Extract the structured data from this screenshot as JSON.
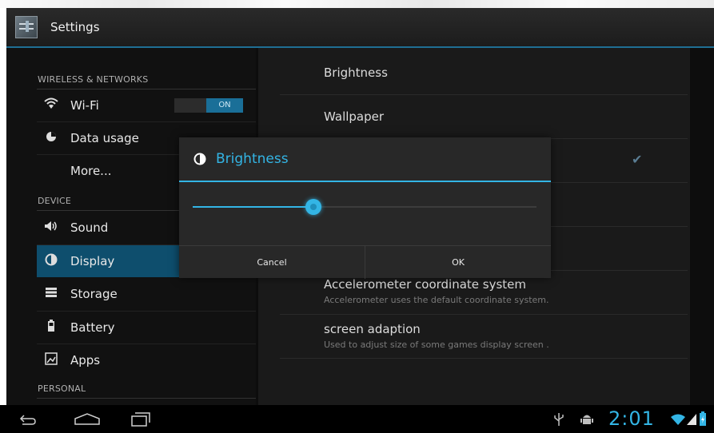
{
  "app": {
    "title": "Settings"
  },
  "sidebar": {
    "headers": {
      "wireless": "WIRELESS & NETWORKS",
      "device": "DEVICE",
      "personal": "PERSONAL"
    },
    "items": [
      {
        "label": "Wi-Fi",
        "icon": "wifi-icon"
      },
      {
        "label": "Data usage",
        "icon": "data-usage-icon"
      },
      {
        "label": "More...",
        "icon": ""
      },
      {
        "label": "Sound",
        "icon": "speaker-icon"
      },
      {
        "label": "Display",
        "icon": "brightness-icon",
        "active": true
      },
      {
        "label": "Storage",
        "icon": "storage-icon"
      },
      {
        "label": "Battery",
        "icon": "battery-icon"
      },
      {
        "label": "Apps",
        "icon": "apps-icon"
      }
    ],
    "wifi_toggle": "ON"
  },
  "display_settings": [
    {
      "title": "Brightness"
    },
    {
      "title": "Wallpaper"
    },
    {
      "title": "Accelerometer coordinate system",
      "summary": "Accelerometer uses the default coordinate system."
    },
    {
      "title": "screen adaption",
      "summary": "Used to adjust size of some games display screen ."
    }
  ],
  "dialog": {
    "title": "Brightness",
    "slider_value": 0.35,
    "cancel_label": "Cancel",
    "ok_label": "OK"
  },
  "status": {
    "time": "2:01"
  },
  "colors": {
    "accent": "#33b5e5",
    "selected": "#0e4e6d"
  }
}
